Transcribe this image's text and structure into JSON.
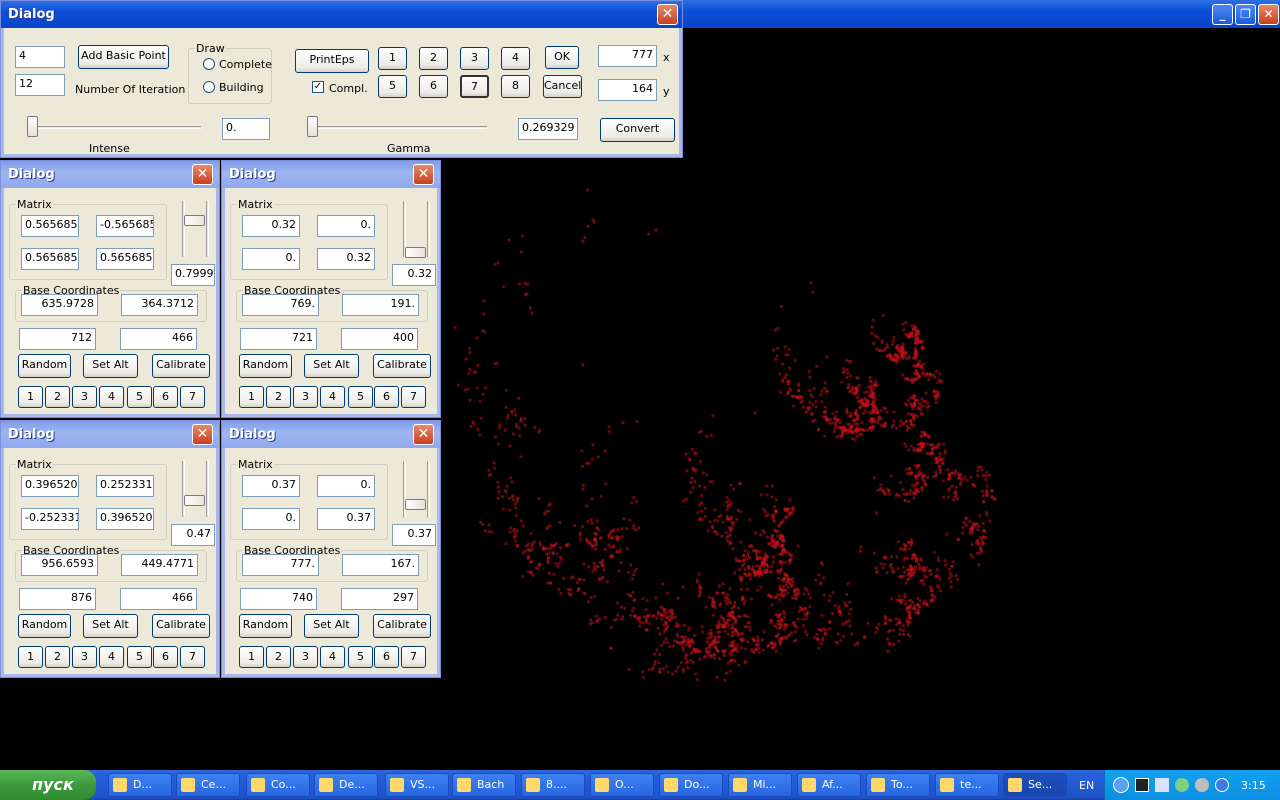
{
  "main": {
    "title": "Dialog",
    "basic_point_value": "4",
    "iterations_value": "12",
    "add_basic_point": "Add Basic Point",
    "iterations_label": "Number Of Iteration",
    "draw_group": "Draw",
    "draw_options": [
      "Complete",
      "Building"
    ],
    "print_eps": "PrintEps",
    "compl_label": "Compl.",
    "compl_checked": true,
    "num_buttons": [
      "1",
      "2",
      "3",
      "4",
      "5",
      "6",
      "7",
      "8"
    ],
    "selected_num": "7",
    "ok": "OK",
    "cancel": "Cancel",
    "x_value": "777",
    "x_label": "x",
    "y_value": "164",
    "y_label": "y",
    "intense_value": "0.",
    "intense_label": "Intense",
    "gamma_value": "0.269329",
    "gamma_label": "Gamma",
    "convert": "Convert"
  },
  "sub_dialogs": [
    {
      "title": "Dialog",
      "m": [
        "0.565685",
        "-0.565685",
        "0.565685",
        "0.565685"
      ],
      "slider_value": "0.7999",
      "base": [
        "635.9728",
        "364.3712"
      ],
      "coords": [
        "712",
        "466"
      ]
    },
    {
      "title": "Dialog",
      "m": [
        "0.32",
        "0.",
        "0.",
        "0.32"
      ],
      "slider_value": "0.32",
      "base": [
        "769.",
        "191."
      ],
      "coords": [
        "721",
        "400"
      ]
    },
    {
      "title": "Dialog",
      "m": [
        "0.396520",
        "0.252331",
        "-0.252331",
        "0.396520"
      ],
      "slider_value": "0.47",
      "base": [
        "956.6593",
        "449.4771"
      ],
      "coords": [
        "876",
        "466"
      ]
    },
    {
      "title": "Dialog",
      "m": [
        "0.37",
        "0.",
        "0.",
        "0.37"
      ],
      "slider_value": "0.37",
      "base": [
        "777.",
        "167."
      ],
      "coords": [
        "740",
        "297"
      ]
    }
  ],
  "sub_labels": {
    "matrix": "Matrix",
    "base": "Base Coordinates",
    "random": "Random",
    "set_alt": "Set Alt",
    "calibrate": "Calibrate",
    "nums": [
      "1",
      "2",
      "3",
      "4",
      "5",
      "6",
      "7"
    ]
  },
  "fractal_color": "#c0101a",
  "taskbar": {
    "start": "пуск",
    "tasks": [
      "D...",
      "Ce...",
      "Co...",
      "De...",
      "VS...",
      "Bach",
      "8....",
      "O...",
      "Do...",
      "Mi...",
      "Af...",
      "To...",
      "te...",
      "Se..."
    ],
    "lang": "EN",
    "time": "3:15"
  }
}
